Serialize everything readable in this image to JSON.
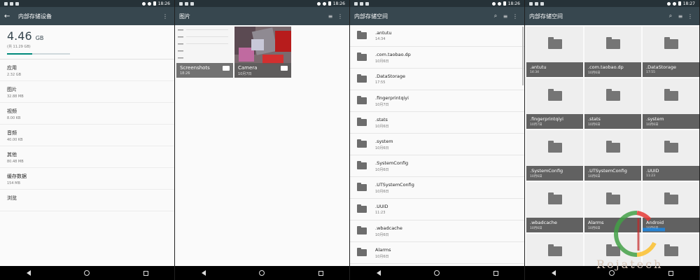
{
  "panels": [
    {
      "status": {
        "time": "18:26"
      },
      "title": "内部存储设备",
      "storage": {
        "used": "4.46",
        "unit": "GB",
        "total": "(共 11.29 GB)",
        "percent_used": 39.5
      },
      "categories": [
        {
          "label": "应用",
          "value": "2.32 GB"
        },
        {
          "label": "图片",
          "value": "32.88 MB"
        },
        {
          "label": "视频",
          "value": "8.00 KB"
        },
        {
          "label": "音频",
          "value": "40.00 KB"
        },
        {
          "label": "其他",
          "value": "80.48 MB"
        },
        {
          "label": "缓存数据",
          "value": "154 MB"
        },
        {
          "label": "浏览",
          "value": ""
        }
      ]
    },
    {
      "status": {
        "time": "18:26"
      },
      "title": "图片",
      "albums": [
        {
          "name": "Screenshots",
          "date": "18:26"
        },
        {
          "name": "Camera",
          "date": "10月7日"
        }
      ]
    },
    {
      "status": {
        "time": "18:26"
      },
      "title": "内部存储空间",
      "files": [
        {
          "name": ".antutu",
          "date": "14:34"
        },
        {
          "name": ".com.taobao.dp",
          "date": "10月6日"
        },
        {
          "name": ".DataStorage",
          "date": "17:55"
        },
        {
          "name": ".fingerprintqiyi",
          "date": "10月7日"
        },
        {
          "name": ".stats",
          "date": "10月6日"
        },
        {
          "name": ".system",
          "date": "10月6日"
        },
        {
          "name": ".SystemConfig",
          "date": "10月6日"
        },
        {
          "name": ".UTSystemConfig",
          "date": "10月6日"
        },
        {
          "name": ".UUID",
          "date": "11:23"
        },
        {
          "name": ".wbadcache",
          "date": "10月6日"
        },
        {
          "name": "Alarms",
          "date": "10月6日"
        }
      ]
    },
    {
      "status": {
        "time": "18:27"
      },
      "title": "内部存储空间",
      "files": [
        {
          "name": ".antutu",
          "date": "14:34"
        },
        {
          "name": ".com.taobao.dp",
          "date": "10月6日"
        },
        {
          "name": ".DataStorage",
          "date": "17:55"
        },
        {
          "name": ".fingerprintqiyi",
          "date": "10月7日"
        },
        {
          "name": ".stats",
          "date": "10月6日"
        },
        {
          "name": ".system",
          "date": "10月6日"
        },
        {
          "name": ".SystemConfig",
          "date": "10月6日"
        },
        {
          "name": ".UTSystemConfig",
          "date": "10月6日"
        },
        {
          "name": ".UUID",
          "date": "11:23"
        },
        {
          "name": ".wbadcache",
          "date": "10月6日"
        },
        {
          "name": "Alarms",
          "date": "10月6日"
        },
        {
          "name": "Android",
          "date": "10月6日"
        }
      ]
    }
  ],
  "icons": {
    "back": "arrow-left-icon",
    "more": "more-vert-icon",
    "sort": "sort-icon",
    "search": "search-icon",
    "folder": "folder-icon",
    "nav_back": "nav-back-icon",
    "nav_home": "nav-home-icon",
    "nav_recents": "nav-recents-icon"
  },
  "colors": {
    "appbar": "#37474f",
    "statusbar": "#263238",
    "accent": "#00897b"
  },
  "watermark": "Rojatech"
}
